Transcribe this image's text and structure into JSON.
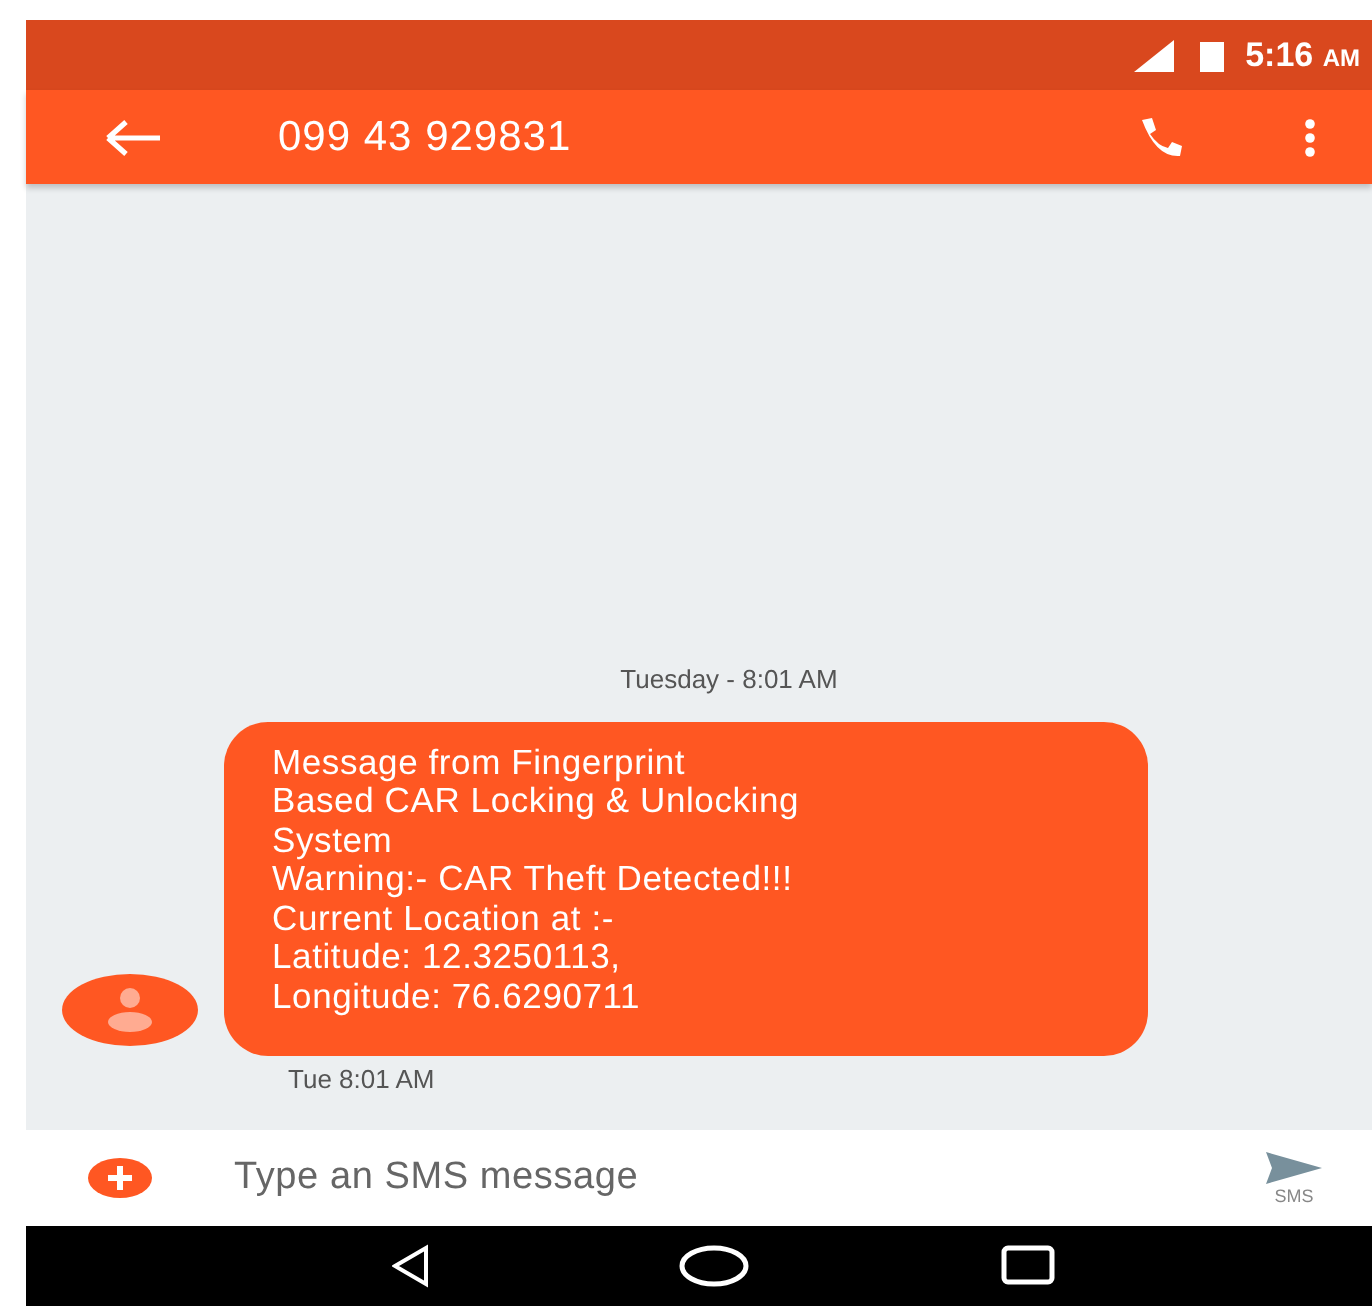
{
  "status_bar": {
    "time": "5:16",
    "ampm": "AM"
  },
  "app_bar": {
    "title": "099 43 929831"
  },
  "thread": {
    "date_divider": "Tuesday - 8:01 AM",
    "messages": [
      {
        "text": "Message from Fingerprint\nBased CAR Locking & Unlocking\nSystem\nWarning:- CAR Theft Detected!!!\nCurrent Location at :-\nLatitude: 12.3250113,\nLongitude: 76.6290711",
        "timestamp": "Tue 8:01 AM"
      }
    ]
  },
  "composer": {
    "placeholder": "Type an SMS message",
    "send_label": "SMS"
  }
}
